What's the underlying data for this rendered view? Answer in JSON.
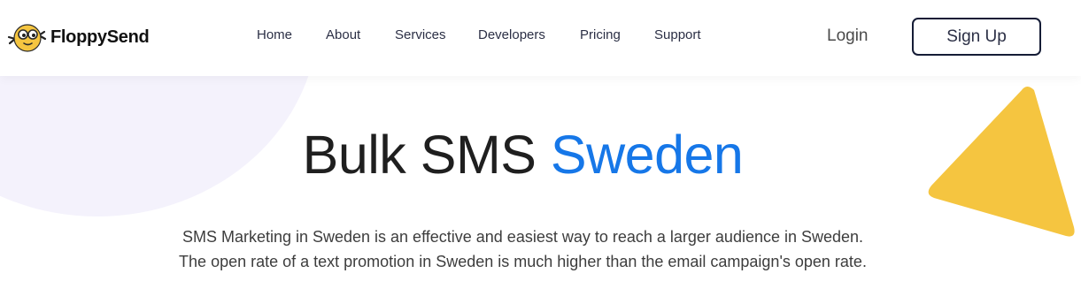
{
  "brand": {
    "name": "FloppySend",
    "logo_icon": "floppy-mascot-icon",
    "colors": {
      "accent_blue": "#1677e8",
      "mascot_yellow": "#f5c540",
      "dark_navy": "#151c36"
    }
  },
  "nav": {
    "items": [
      {
        "label": "Home"
      },
      {
        "label": "About"
      },
      {
        "label": "Services"
      },
      {
        "label": "Developers"
      },
      {
        "label": "Pricing"
      },
      {
        "label": "Support"
      }
    ],
    "login_label": "Login",
    "signup_label": "Sign Up"
  },
  "hero": {
    "title_part1": "Bulk SMS",
    "title_accent": "Sweden",
    "description_line1": "SMS Marketing in Sweden is an effective and easiest way to reach a larger audience in Sweden.",
    "description_line2": "The open rate of a text promotion in Sweden is much higher than the email campaign's open rate."
  }
}
